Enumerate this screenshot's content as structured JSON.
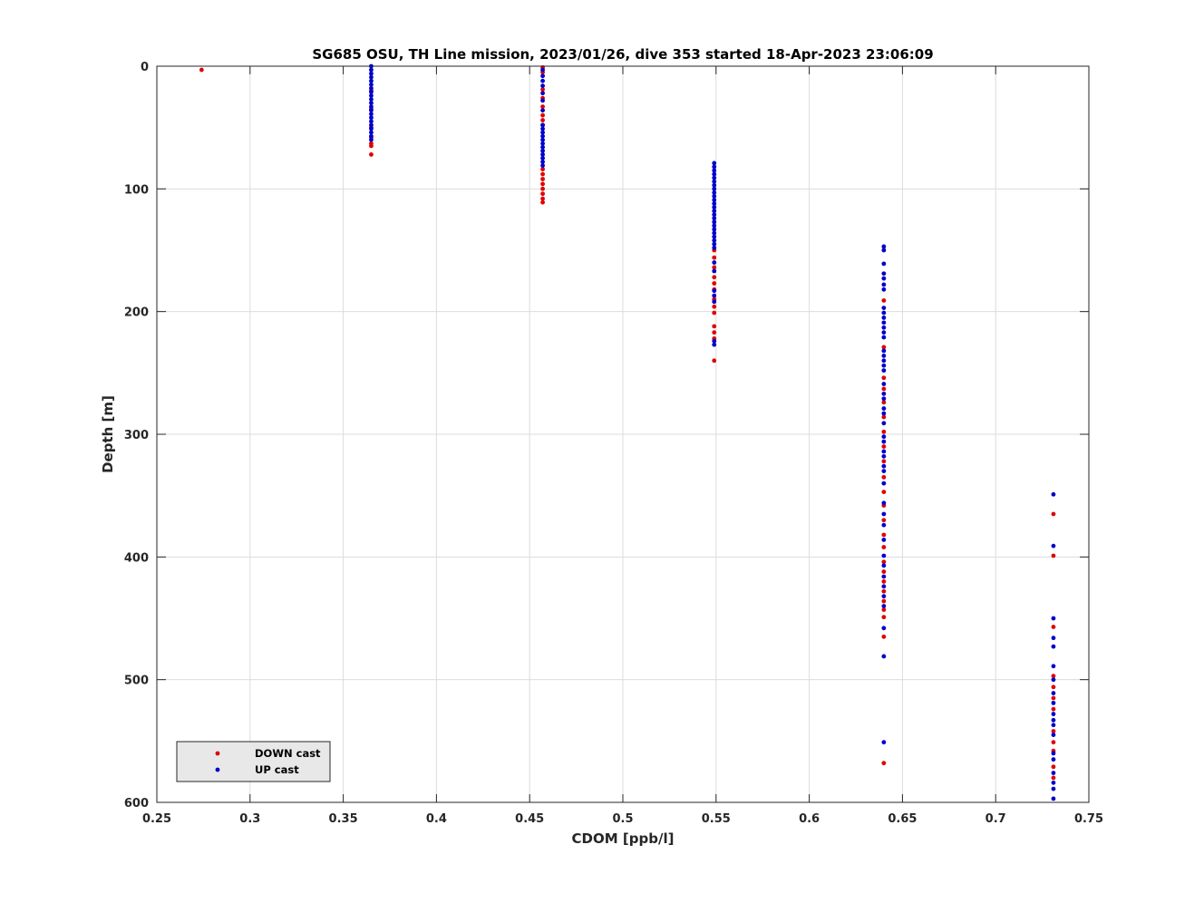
{
  "chart_data": {
    "type": "scatter",
    "title": "SG685 OSU, TH Line mission, 2023/01/26, dive 353 started 18-Apr-2023 23:06:09",
    "xlabel": "CDOM [ppb/l]",
    "ylabel": "Depth [m]",
    "xlim": [
      0.25,
      0.75
    ],
    "ylim": [
      0,
      600
    ],
    "y_reversed": true,
    "grid": true,
    "legend_position": "bottom-left",
    "x_ticks": [
      0.25,
      0.3,
      0.35,
      0.4,
      0.45,
      0.5,
      0.55,
      0.6,
      0.65,
      0.7,
      0.75
    ],
    "x_tick_labels": [
      "0.25",
      "0.3",
      "0.35",
      "0.4",
      "0.45",
      "0.5",
      "0.55",
      "0.6",
      "0.65",
      "0.7",
      "0.75"
    ],
    "y_ticks": [
      0,
      100,
      200,
      300,
      400,
      500,
      600
    ],
    "y_tick_labels": [
      "0",
      "100",
      "200",
      "300",
      "400",
      "500",
      "600"
    ],
    "series": [
      {
        "name": "DOWN cast",
        "color": "#e00000",
        "points": [
          {
            "x": 0.274,
            "y": 3
          },
          {
            "x": 0.365,
            "y": 20
          },
          {
            "x": 0.365,
            "y": 35
          },
          {
            "x": 0.365,
            "y": 50
          },
          {
            "x": 0.365,
            "y": 58
          },
          {
            "x": 0.365,
            "y": 63
          },
          {
            "x": 0.365,
            "y": 65
          },
          {
            "x": 0.365,
            "y": 72
          },
          {
            "x": 0.457,
            "y": 1
          },
          {
            "x": 0.457,
            "y": 5
          },
          {
            "x": 0.457,
            "y": 19
          },
          {
            "x": 0.457,
            "y": 26
          },
          {
            "x": 0.457,
            "y": 33
          },
          {
            "x": 0.457,
            "y": 40
          },
          {
            "x": 0.457,
            "y": 44
          },
          {
            "x": 0.457,
            "y": 48
          },
          {
            "x": 0.457,
            "y": 84
          },
          {
            "x": 0.457,
            "y": 88
          },
          {
            "x": 0.457,
            "y": 92
          },
          {
            "x": 0.457,
            "y": 96
          },
          {
            "x": 0.457,
            "y": 100
          },
          {
            "x": 0.457,
            "y": 104
          },
          {
            "x": 0.457,
            "y": 108
          },
          {
            "x": 0.457,
            "y": 111
          },
          {
            "x": 0.549,
            "y": 150
          },
          {
            "x": 0.549,
            "y": 156
          },
          {
            "x": 0.549,
            "y": 164
          },
          {
            "x": 0.549,
            "y": 172
          },
          {
            "x": 0.549,
            "y": 177
          },
          {
            "x": 0.549,
            "y": 182
          },
          {
            "x": 0.549,
            "y": 190
          },
          {
            "x": 0.549,
            "y": 196
          },
          {
            "x": 0.549,
            "y": 201
          },
          {
            "x": 0.549,
            "y": 212
          },
          {
            "x": 0.549,
            "y": 217
          },
          {
            "x": 0.549,
            "y": 222
          },
          {
            "x": 0.549,
            "y": 240
          },
          {
            "x": 0.64,
            "y": 191
          },
          {
            "x": 0.64,
            "y": 229
          },
          {
            "x": 0.64,
            "y": 254
          },
          {
            "x": 0.64,
            "y": 263
          },
          {
            "x": 0.64,
            "y": 274
          },
          {
            "x": 0.64,
            "y": 286
          },
          {
            "x": 0.64,
            "y": 298
          },
          {
            "x": 0.64,
            "y": 310
          },
          {
            "x": 0.64,
            "y": 322
          },
          {
            "x": 0.64,
            "y": 335
          },
          {
            "x": 0.64,
            "y": 347
          },
          {
            "x": 0.64,
            "y": 358
          },
          {
            "x": 0.64,
            "y": 370
          },
          {
            "x": 0.64,
            "y": 382
          },
          {
            "x": 0.64,
            "y": 392
          },
          {
            "x": 0.64,
            "y": 404
          },
          {
            "x": 0.64,
            "y": 412
          },
          {
            "x": 0.64,
            "y": 420
          },
          {
            "x": 0.64,
            "y": 428
          },
          {
            "x": 0.64,
            "y": 436
          },
          {
            "x": 0.64,
            "y": 443
          },
          {
            "x": 0.64,
            "y": 449
          },
          {
            "x": 0.64,
            "y": 465
          },
          {
            "x": 0.64,
            "y": 568
          },
          {
            "x": 0.731,
            "y": 365
          },
          {
            "x": 0.731,
            "y": 399
          },
          {
            "x": 0.731,
            "y": 457
          },
          {
            "x": 0.731,
            "y": 497
          },
          {
            "x": 0.731,
            "y": 506
          },
          {
            "x": 0.731,
            "y": 515
          },
          {
            "x": 0.731,
            "y": 524
          },
          {
            "x": 0.731,
            "y": 542
          },
          {
            "x": 0.731,
            "y": 551
          },
          {
            "x": 0.731,
            "y": 558
          },
          {
            "x": 0.731,
            "y": 571
          },
          {
            "x": 0.731,
            "y": 580
          }
        ]
      },
      {
        "name": "UP cast",
        "color": "#0000cc",
        "points": [
          {
            "x": 0.365,
            "y": 0
          },
          {
            "x": 0.365,
            "y": 3
          },
          {
            "x": 0.365,
            "y": 6
          },
          {
            "x": 0.365,
            "y": 9
          },
          {
            "x": 0.365,
            "y": 12
          },
          {
            "x": 0.365,
            "y": 15
          },
          {
            "x": 0.365,
            "y": 18
          },
          {
            "x": 0.365,
            "y": 21
          },
          {
            "x": 0.365,
            "y": 24
          },
          {
            "x": 0.365,
            "y": 27
          },
          {
            "x": 0.365,
            "y": 30
          },
          {
            "x": 0.365,
            "y": 33
          },
          {
            "x": 0.365,
            "y": 36
          },
          {
            "x": 0.365,
            "y": 39
          },
          {
            "x": 0.365,
            "y": 42
          },
          {
            "x": 0.365,
            "y": 45
          },
          {
            "x": 0.365,
            "y": 48
          },
          {
            "x": 0.365,
            "y": 51
          },
          {
            "x": 0.365,
            "y": 54
          },
          {
            "x": 0.365,
            "y": 57
          },
          {
            "x": 0.365,
            "y": 60
          },
          {
            "x": 0.457,
            "y": 3
          },
          {
            "x": 0.457,
            "y": 8
          },
          {
            "x": 0.457,
            "y": 12
          },
          {
            "x": 0.457,
            "y": 16
          },
          {
            "x": 0.457,
            "y": 22
          },
          {
            "x": 0.457,
            "y": 28
          },
          {
            "x": 0.457,
            "y": 36
          },
          {
            "x": 0.457,
            "y": 48
          },
          {
            "x": 0.457,
            "y": 51
          },
          {
            "x": 0.457,
            "y": 54
          },
          {
            "x": 0.457,
            "y": 57
          },
          {
            "x": 0.457,
            "y": 60
          },
          {
            "x": 0.457,
            "y": 63
          },
          {
            "x": 0.457,
            "y": 66
          },
          {
            "x": 0.457,
            "y": 69
          },
          {
            "x": 0.457,
            "y": 72
          },
          {
            "x": 0.457,
            "y": 75
          },
          {
            "x": 0.457,
            "y": 78
          },
          {
            "x": 0.457,
            "y": 81
          },
          {
            "x": 0.549,
            "y": 79
          },
          {
            "x": 0.549,
            "y": 82
          },
          {
            "x": 0.549,
            "y": 85
          },
          {
            "x": 0.549,
            "y": 88
          },
          {
            "x": 0.549,
            "y": 91
          },
          {
            "x": 0.549,
            "y": 94
          },
          {
            "x": 0.549,
            "y": 97
          },
          {
            "x": 0.549,
            "y": 100
          },
          {
            "x": 0.549,
            "y": 103
          },
          {
            "x": 0.549,
            "y": 106
          },
          {
            "x": 0.549,
            "y": 109
          },
          {
            "x": 0.549,
            "y": 112
          },
          {
            "x": 0.549,
            "y": 115
          },
          {
            "x": 0.549,
            "y": 118
          },
          {
            "x": 0.549,
            "y": 121
          },
          {
            "x": 0.549,
            "y": 124
          },
          {
            "x": 0.549,
            "y": 127
          },
          {
            "x": 0.549,
            "y": 130
          },
          {
            "x": 0.549,
            "y": 133
          },
          {
            "x": 0.549,
            "y": 136
          },
          {
            "x": 0.549,
            "y": 139
          },
          {
            "x": 0.549,
            "y": 142
          },
          {
            "x": 0.549,
            "y": 145
          },
          {
            "x": 0.549,
            "y": 148
          },
          {
            "x": 0.549,
            "y": 160
          },
          {
            "x": 0.549,
            "y": 167
          },
          {
            "x": 0.549,
            "y": 183
          },
          {
            "x": 0.549,
            "y": 187
          },
          {
            "x": 0.549,
            "y": 192
          },
          {
            "x": 0.549,
            "y": 224
          },
          {
            "x": 0.549,
            "y": 227
          },
          {
            "x": 0.64,
            "y": 147
          },
          {
            "x": 0.64,
            "y": 150
          },
          {
            "x": 0.64,
            "y": 161
          },
          {
            "x": 0.64,
            "y": 169
          },
          {
            "x": 0.64,
            "y": 173
          },
          {
            "x": 0.64,
            "y": 178
          },
          {
            "x": 0.64,
            "y": 182
          },
          {
            "x": 0.64,
            "y": 197
          },
          {
            "x": 0.64,
            "y": 201
          },
          {
            "x": 0.64,
            "y": 205
          },
          {
            "x": 0.64,
            "y": 209
          },
          {
            "x": 0.64,
            "y": 213
          },
          {
            "x": 0.64,
            "y": 217
          },
          {
            "x": 0.64,
            "y": 221
          },
          {
            "x": 0.64,
            "y": 232
          },
          {
            "x": 0.64,
            "y": 236
          },
          {
            "x": 0.64,
            "y": 240
          },
          {
            "x": 0.64,
            "y": 244
          },
          {
            "x": 0.64,
            "y": 248
          },
          {
            "x": 0.64,
            "y": 259
          },
          {
            "x": 0.64,
            "y": 267
          },
          {
            "x": 0.64,
            "y": 271
          },
          {
            "x": 0.64,
            "y": 279
          },
          {
            "x": 0.64,
            "y": 283
          },
          {
            "x": 0.64,
            "y": 291
          },
          {
            "x": 0.64,
            "y": 302
          },
          {
            "x": 0.64,
            "y": 306
          },
          {
            "x": 0.64,
            "y": 314
          },
          {
            "x": 0.64,
            "y": 318
          },
          {
            "x": 0.64,
            "y": 326
          },
          {
            "x": 0.64,
            "y": 330
          },
          {
            "x": 0.64,
            "y": 340
          },
          {
            "x": 0.64,
            "y": 356
          },
          {
            "x": 0.64,
            "y": 365
          },
          {
            "x": 0.64,
            "y": 374
          },
          {
            "x": 0.64,
            "y": 386
          },
          {
            "x": 0.64,
            "y": 399
          },
          {
            "x": 0.64,
            "y": 407
          },
          {
            "x": 0.64,
            "y": 416
          },
          {
            "x": 0.64,
            "y": 424
          },
          {
            "x": 0.64,
            "y": 432
          },
          {
            "x": 0.64,
            "y": 440
          },
          {
            "x": 0.64,
            "y": 458
          },
          {
            "x": 0.64,
            "y": 481
          },
          {
            "x": 0.64,
            "y": 551
          },
          {
            "x": 0.731,
            "y": 349
          },
          {
            "x": 0.731,
            "y": 391
          },
          {
            "x": 0.731,
            "y": 450
          },
          {
            "x": 0.731,
            "y": 466
          },
          {
            "x": 0.731,
            "y": 473
          },
          {
            "x": 0.731,
            "y": 489
          },
          {
            "x": 0.731,
            "y": 500
          },
          {
            "x": 0.731,
            "y": 511
          },
          {
            "x": 0.731,
            "y": 519
          },
          {
            "x": 0.731,
            "y": 528
          },
          {
            "x": 0.731,
            "y": 533
          },
          {
            "x": 0.731,
            "y": 537
          },
          {
            "x": 0.731,
            "y": 545
          },
          {
            "x": 0.731,
            "y": 560
          },
          {
            "x": 0.731,
            "y": 565
          },
          {
            "x": 0.731,
            "y": 576
          },
          {
            "x": 0.731,
            "y": 584
          },
          {
            "x": 0.731,
            "y": 589
          },
          {
            "x": 0.731,
            "y": 597
          }
        ]
      }
    ]
  }
}
